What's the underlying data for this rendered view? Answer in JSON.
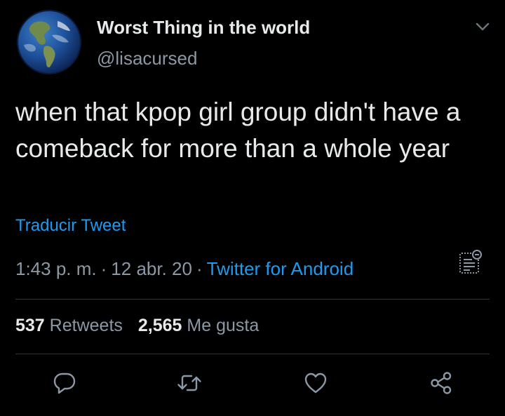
{
  "user": {
    "display_name": "Worst Thing in the world",
    "handle": "@lisacursed",
    "avatar_icon": "earth-globe-avatar"
  },
  "tweet": {
    "text": "when that kpop girl group didn't have a comeback for more than a whole year",
    "translate_label": "Traducir Tweet"
  },
  "meta": {
    "time": "1:43 p. m.",
    "separator": "·",
    "date": "12 abr. 20",
    "source": "Twitter for Android"
  },
  "stats": {
    "retweets_count": "537",
    "retweets_label": "Retweets",
    "likes_count": "2,565",
    "likes_label": "Me gusta"
  },
  "actions": [
    "reply-icon",
    "retweet-icon",
    "like-icon",
    "share-icon"
  ],
  "colors": {
    "background": "#000000",
    "text": "#e7e9ea",
    "secondary": "#8b98a5",
    "accent": "#1d9bf0",
    "divider": "#2f3336"
  }
}
